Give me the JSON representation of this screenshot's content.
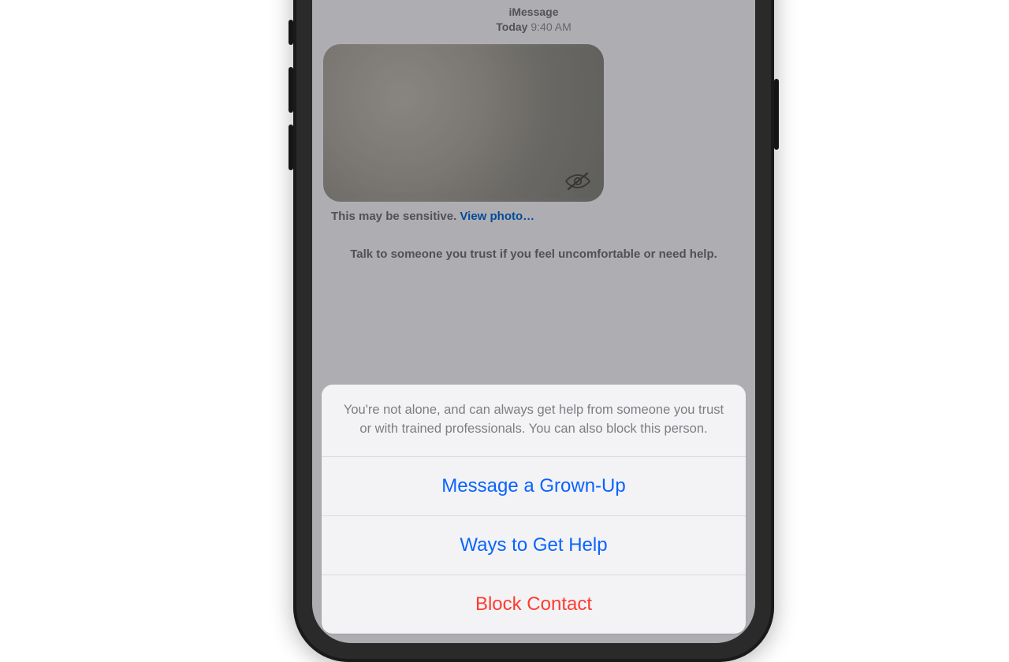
{
  "conversation": {
    "service_label": "iMessage",
    "timestamp_prefix": "Today",
    "timestamp_time": "9:40 AM",
    "sensitive_caption": "This may be sensitive.",
    "view_photo_link": "View photo…",
    "trust_line": "Talk to someone you trust if you feel uncomfortable or need help."
  },
  "sheet": {
    "header": "You're not alone, and can always get help from someone you trust or with trained professionals. You can also block this person.",
    "message_grownup": "Message a Grown-Up",
    "ways_to_get_help": "Ways to Get Help",
    "block_contact": "Block Contact"
  },
  "colors": {
    "ios_blue": "#0a63ff",
    "ios_red": "#ff3b30"
  }
}
